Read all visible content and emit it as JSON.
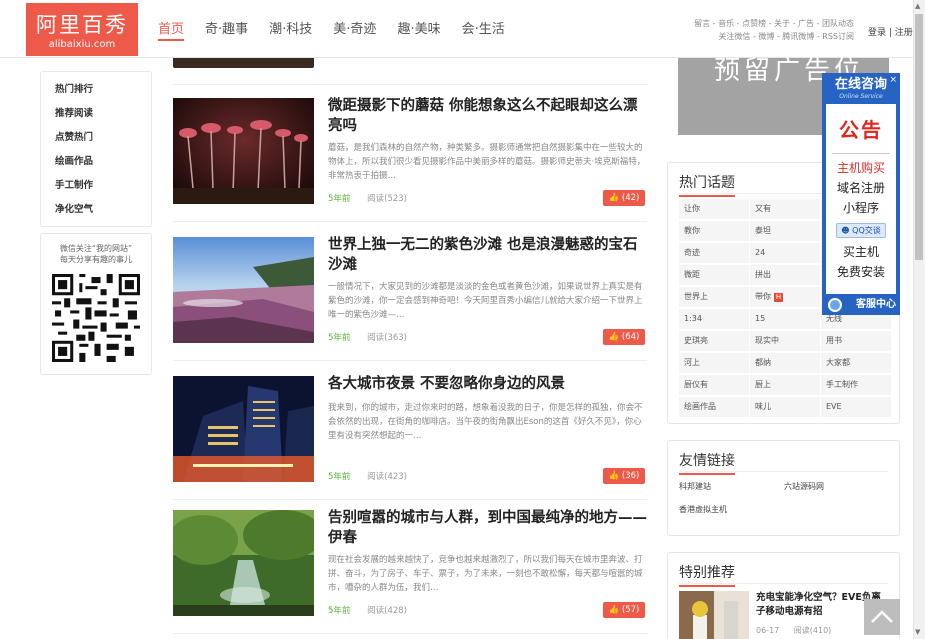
{
  "header": {
    "logo_cn": "阿里百秀",
    "logo_en": "alibaixiu.com",
    "nav": [
      "首页",
      "奇·趣事",
      "潮·科技",
      "美·奇迹",
      "趣·美味",
      "会·生活"
    ],
    "toplinks_line1": "留言 - 音乐 - 点赞榜 - 关于 - 广告 - 团队动态",
    "toplinks_line2": "关注微信 - 微博 - 腾讯微博 - RSS订阅",
    "login": "登录 | 注册"
  },
  "left_menu": [
    "热门排行",
    "推荐阅读",
    "点赞热门",
    "绘画作品",
    "手工制作",
    "净化空气"
  ],
  "wechat": {
    "line1": "微信关注“我的网站”",
    "line2": "每天分享有趣的事儿"
  },
  "articles": [
    {
      "title": "微距摄影下的蘑菇 你能想象这么不起眼却这么漂亮吗",
      "desc": "蘑菇，是我们森林的自然产物，种类繁多。摄影师通常把自然摄影集中在一些较大的物体上，所以我们很少看见摄影作品中美丽多样的蘑菇。摄影师史蒂夫·埃克斯福特，非常热衷于拍摄…",
      "time": "5年前",
      "read": "阅读(523)",
      "likes": "(42)"
    },
    {
      "title": "世界上独一无二的紫色沙滩 也是浪漫魅惑的宝石沙滩",
      "desc": "一般情况下，大家见到的沙滩都是淡淡的金色或者黄色沙滩，如果说世界上真实是有紫色的沙滩，你一定会感到神奇吧！今天阿里百秀小编信儿就给大家介绍一下世界上唯一的紫色沙滩—…",
      "time": "5年前",
      "read": "阅读(363)",
      "likes": "(64)"
    },
    {
      "title": "各大城市夜景 不要忽略你身边的风景",
      "desc": "我来到，你的城市，走过你来时的路，想象着没我的日子，你是怎样的孤独，你会不会依然的出现，在街角的咖啡店。当午夜的街角飘出Eson的这首《好久不见》，你心里有没有突然想起的一…",
      "time": "5年前",
      "read": "阅读(423)",
      "likes": "(36)"
    },
    {
      "title": "告别喧嚣的城市与人群，到中国最纯净的地方——伊春",
      "desc": "现在社会发展的越来越快了，竞争也越来越激烈了，所以我们每天在城市里奔波、打拼、奋斗，为了房子、车子、票子，为了未来，一刻也不敢松懈，每天都与喧嚣的城市，嘈杂的人群为伍，我们…",
      "time": "5年前",
      "read": "阅读(428)",
      "likes": "(57)"
    }
  ],
  "ad_text": "预留广告位",
  "hot_topics": {
    "title": "热门话题",
    "items": [
      "让你",
      "又有",
      "一个",
      "教你",
      "泰坦",
      "如何",
      "奇迹",
      "24",
      "",
      "微距",
      "拼出",
      "",
      "世界上",
      "带你",
      "",
      "1:34",
      "15",
      "无线",
      "史琪亮",
      "现实中",
      "用书",
      "河上",
      "都纳",
      "大家都",
      "厨仪有",
      "厨上",
      "手工制作",
      "绘画作品",
      "味儿",
      "EVE"
    ],
    "hot_index": 13
  },
  "friends": {
    "title": "友情链接",
    "links": [
      "科邦建站",
      "六站源码网",
      "香港虚拟主机"
    ]
  },
  "special": {
    "title": "特别推荐",
    "item_title": "充电宝能净化空气？EVE负离子移动电源有招",
    "item_date": "06-17",
    "item_read": "阅读(410)"
  },
  "float_service": {
    "title": "在线咨询",
    "subtitle": "Online Service",
    "close": "×",
    "notice": "公告",
    "lines": [
      "主机购买",
      "域名注册",
      "小程序"
    ],
    "qq": "QQ交谈",
    "lines2": [
      "买主机",
      "免费安装"
    ],
    "footer": "客服中心"
  },
  "colors": {
    "accent": "#ee5a4a",
    "green": "#5ab33a",
    "service_blue": "#2663c2"
  },
  "icons": [
    "thumb-up-icon",
    "close-icon",
    "chevron-up-icon",
    "headset-icon",
    "qq-icon"
  ]
}
